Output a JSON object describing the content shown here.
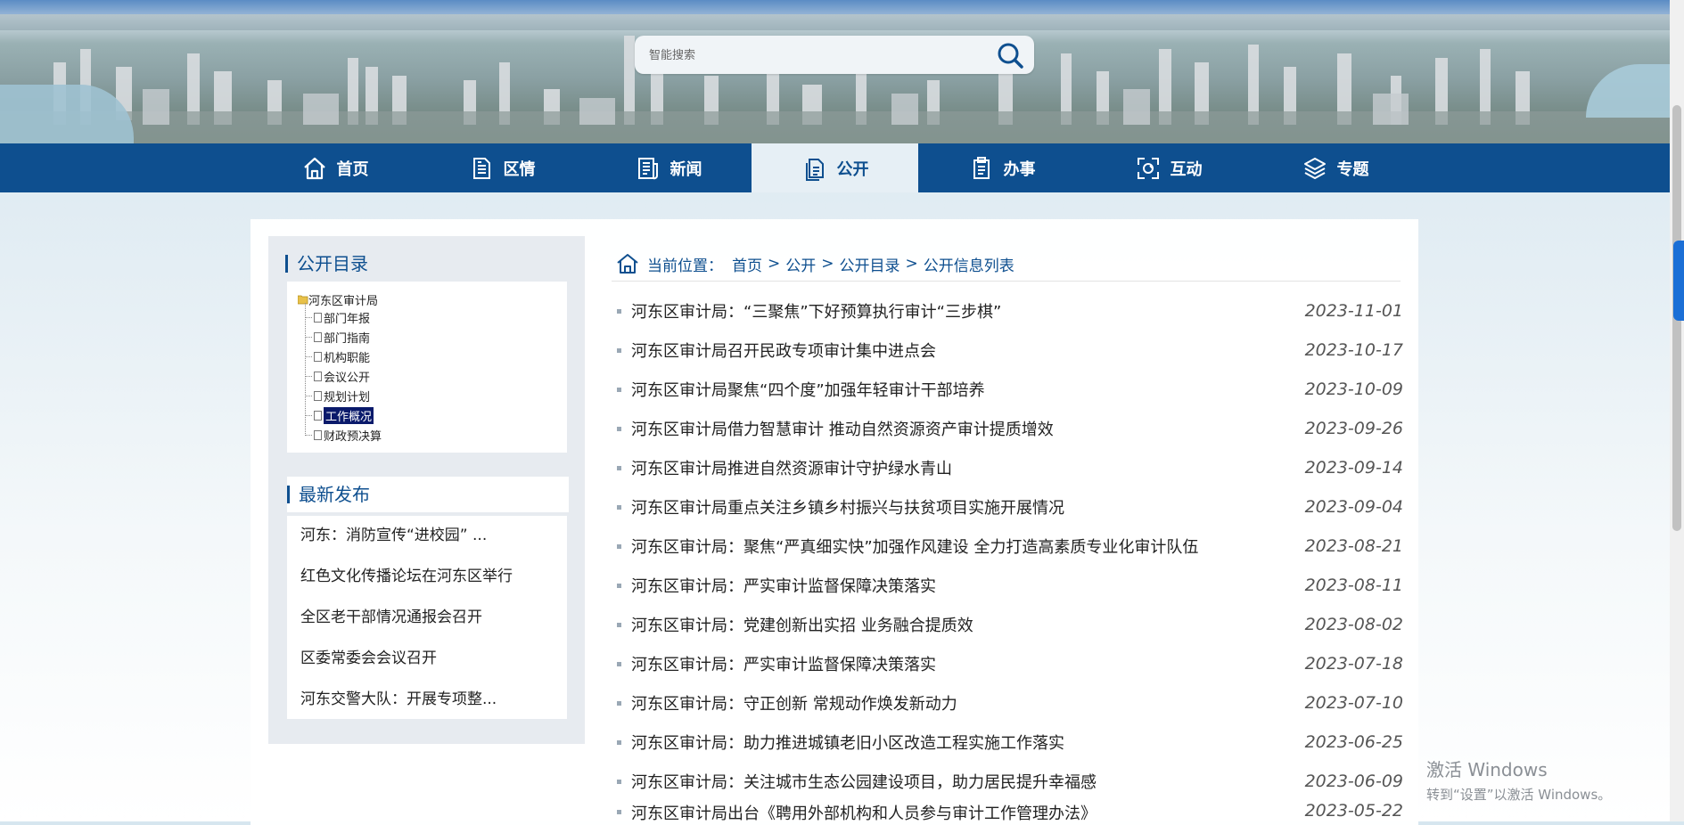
{
  "search": {
    "placeholder": "智能搜索"
  },
  "nav": {
    "items": [
      {
        "label": "首页",
        "icon": "home-icon"
      },
      {
        "label": "区情",
        "icon": "document-icon"
      },
      {
        "label": "新闻",
        "icon": "news-icon"
      },
      {
        "label": "公开",
        "icon": "files-icon",
        "active": true
      },
      {
        "label": "办事",
        "icon": "clipboard-icon"
      },
      {
        "label": "互动",
        "icon": "interact-icon"
      },
      {
        "label": "专题",
        "icon": "layers-icon"
      }
    ]
  },
  "sidebar": {
    "catalog_title": "公开目录",
    "tree_root": "河东区审计局",
    "tree_items": [
      "部门年报",
      "部门指南",
      "机构职能",
      "会议公开",
      "规划计划",
      "工作概况",
      "财政预决算"
    ],
    "selected_item": "工作概况",
    "latest_title": "最新发布",
    "latest_items": [
      "河东：消防宣传“进校园” ...",
      "红色文化传播论坛在河东区举行",
      "全区老干部情况通报会召开",
      "区委常委会会议召开",
      "河东交警大队：开展专项整..."
    ]
  },
  "breadcrumb": {
    "prefix": "当前位置：",
    "items": [
      "首页",
      "公开",
      "公开目录",
      "公开信息列表"
    ],
    "separator": ">"
  },
  "articles": [
    {
      "title": "河东区审计局：“三聚焦”下好预算执行审计“三步棋”",
      "date": "2023-11-01"
    },
    {
      "title": "河东区审计局召开民政专项审计集中进点会",
      "date": "2023-10-17"
    },
    {
      "title": "河东区审计局聚焦“四个度”加强年轻审计干部培养",
      "date": "2023-10-09"
    },
    {
      "title": "河东区审计局借力智慧审计 推动自然资源资产审计提质增效",
      "date": "2023-09-26"
    },
    {
      "title": "河东区审计局推进自然资源审计守护绿水青山",
      "date": "2023-09-14"
    },
    {
      "title": "河东区审计局重点关注乡镇乡村振兴与扶贫项目实施开展情况",
      "date": "2023-09-04"
    },
    {
      "title": "河东区审计局：聚焦“严真细实快”加强作风建设 全力打造高素质专业化审计队伍",
      "date": "2023-08-21"
    },
    {
      "title": "河东区审计局：严实审计监督保障决策落实",
      "date": "2023-08-11"
    },
    {
      "title": "河东区审计局：党建创新出实招 业务融合提质效",
      "date": "2023-08-02"
    },
    {
      "title": "河东区审计局：严实审计监督保障决策落实",
      "date": "2023-07-18"
    },
    {
      "title": "河东区审计局：守正创新 常规动作焕发新动力",
      "date": "2023-07-10"
    },
    {
      "title": "河东区审计局：助力推进城镇老旧小区改造工程实施工作落实",
      "date": "2023-06-25"
    },
    {
      "title": "河东区审计局：关注城市生态公园建设项目，助力居民提升幸福感",
      "date": "2023-06-09"
    },
    {
      "title": "河东区审计局出台《聘用外部机构和人员参与审计工作管理办法》",
      "date": "2023-05-22"
    }
  ],
  "watermark": {
    "line1": "激活 Windows",
    "line2": "转到“设置”以激活 Windows。"
  },
  "colors": {
    "primary": "#0e4f8f",
    "nav_active_bg": "#e6eff5",
    "selected_node": "#0a1a6b"
  }
}
